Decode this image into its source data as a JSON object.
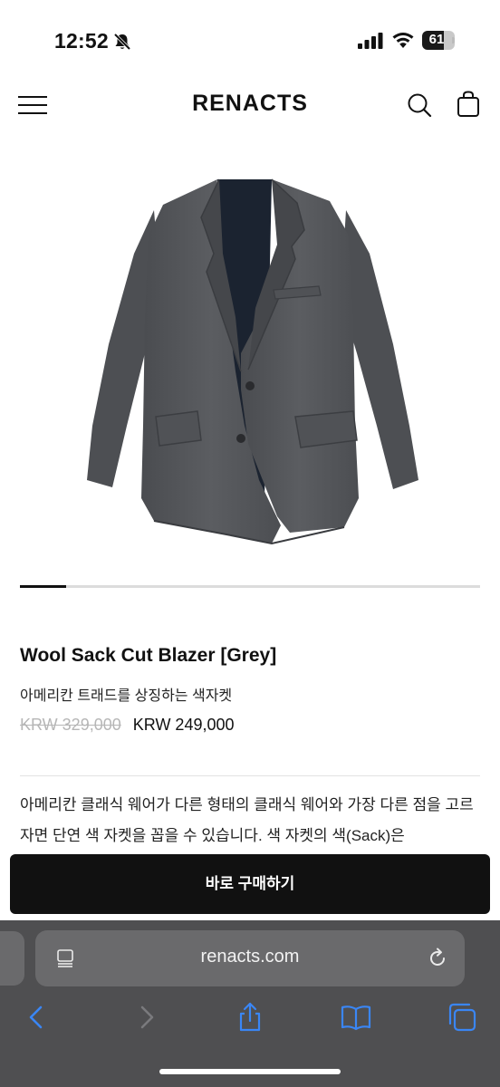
{
  "status_bar": {
    "time": "12:52",
    "battery": "61",
    "battery_level": 0.61,
    "icons": [
      "bell-slash-icon",
      "cellular-signal-icon",
      "wifi-icon",
      "battery-icon"
    ]
  },
  "header": {
    "brand": "RENACTS",
    "icons": [
      "menu-icon",
      "search-icon",
      "shopping-bag-icon"
    ]
  },
  "product": {
    "image_alt_icon": "blazer-image",
    "carousel": {
      "current": 1,
      "total": 7,
      "progress": 0.1
    },
    "name": "Wool Sack Cut Blazer [Grey]",
    "subtitle": "아메리칸 트래드를 상징하는 색자켓",
    "price_original": "KRW 329,000",
    "price_sale": "KRW 249,000",
    "description": "아메리칸 클래식 웨어가 다른 형태의 클래식 웨어와 가장 다른 점을 고르자면 단연 색 자켓을 꼽을 수 있습니다. 색 자켓의 색(Sack)은"
  },
  "buy_button": {
    "label": "바로 구매하기"
  },
  "browser": {
    "url": "renacts.com",
    "toolbar_icons": [
      "back-icon",
      "forward-icon",
      "share-icon",
      "bookmarks-icon",
      "tabs-icon"
    ]
  },
  "colors": {
    "accent": "#111111",
    "browser_bg": "#4f4f51",
    "browser_field": "#6a6a6c",
    "link_blue": "#3a86f5",
    "strike_grey": "#b6b6b6",
    "blazer_grey": "#55575b"
  }
}
